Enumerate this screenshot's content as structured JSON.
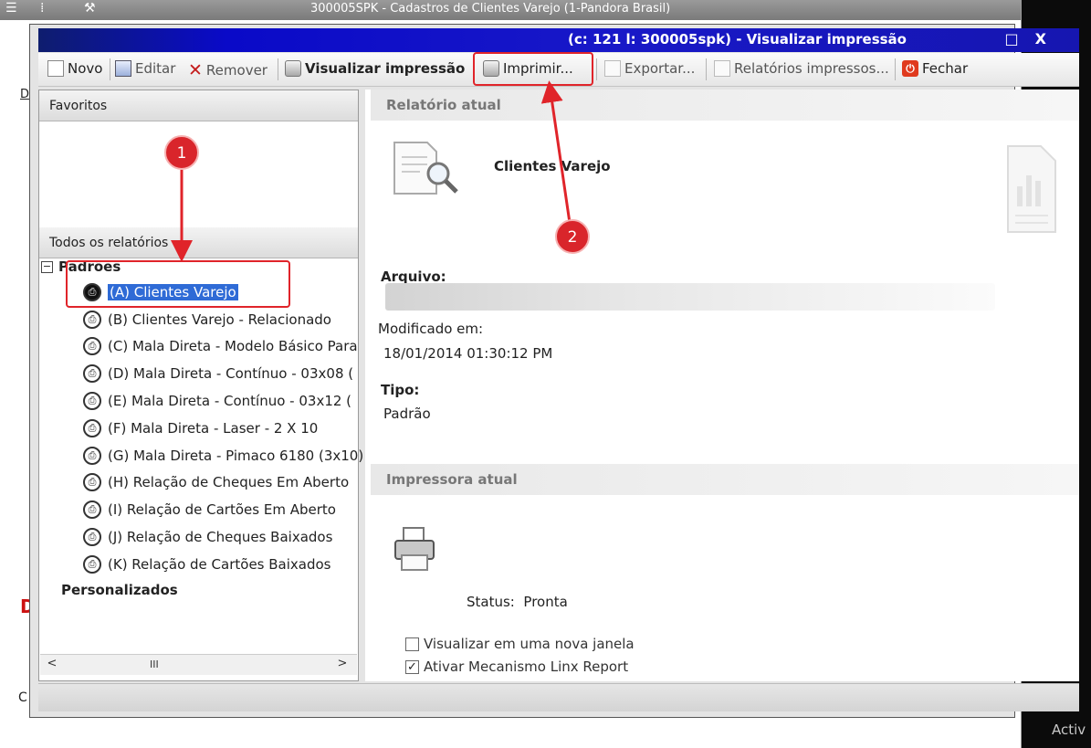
{
  "background_window": {
    "title": "300005SPK - Cadastros de Clientes Varejo (1-Pandora Brasil)",
    "side_letters": [
      "D",
      "D",
      "C"
    ]
  },
  "desktop": {
    "watermark": "Activ"
  },
  "dialog": {
    "title": "(c: 121 l: 300005spk) - Visualizar impressão",
    "title_buttons": [
      "□",
      "X"
    ]
  },
  "toolbar": {
    "novo": "Novo",
    "editar": "Editar",
    "remover": "Remover",
    "visualizar": "Visualizar impressão",
    "imprimir": "Imprimir...",
    "exportar": "Exportar...",
    "relatorios_impressos": "Relatórios impressos...",
    "fechar": "Fechar"
  },
  "left": {
    "favoritos": "Favoritos",
    "todos": "Todos os relatórios",
    "group_padroes": "Padrões",
    "group_personalizados": "Personalizados",
    "expander": "−",
    "reports": [
      "(A) Clientes Varejo",
      "(B) Clientes Varejo - Relacionado",
      "(C) Mala Direta - Modelo Básico Para",
      "(D) Mala Direta - Contínuo - 03x08  (",
      "(E) Mala Direta - Contínuo - 03x12  (",
      "(F) Mala Direta - Laser - 2 X 10",
      "(G) Mala Direta - Pimaco 6180 (3x10)",
      "(H) Relação de Cheques Em Aberto",
      "(I) Relação de Cartões Em Aberto",
      "(J) Relação de Cheques Baixados",
      "(K) Relação de Cartões Baixados"
    ],
    "scroll": {
      "left": "<",
      "thumb": "III",
      "right": ">"
    }
  },
  "right": {
    "relatorio_atual": "Relatório atual",
    "report_name": "Clientes Varejo",
    "arquivo_label": "Arquivo:",
    "modificado_label": "Modificado em:",
    "modificado_value": "18/01/2014 01:30:12 PM",
    "tipo_label": "Tipo:",
    "tipo_value": "Padrão",
    "impressora_atual": "Impressora atual",
    "status_label": "Status:",
    "status_value": "Pronta",
    "chk_nova_janela": "Visualizar em uma nova janela",
    "chk_linx": "Ativar Mecanismo Linx Report",
    "chk_nova_janela_checked": false,
    "chk_linx_checked": true
  },
  "annotations": {
    "marker1": "1",
    "marker2": "2",
    "color": "#d9252b"
  }
}
